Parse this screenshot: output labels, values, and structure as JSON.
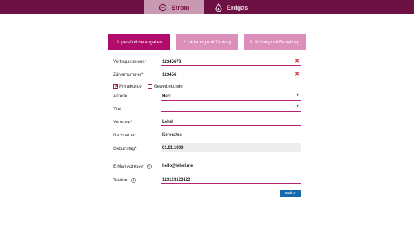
{
  "tabs": {
    "strom": {
      "label": "Strom",
      "icon": "power-icon"
    },
    "erdgas": {
      "label": "Erdgas",
      "icon": "flame-icon"
    }
  },
  "steps": [
    {
      "label": "1. persönliche Angaben",
      "active": true
    },
    {
      "label": "2. Lieferung und Zahlung",
      "active": false
    },
    {
      "label": "3. Prüfung und Bestellung",
      "active": false
    }
  ],
  "form": {
    "vertragskonto": {
      "label": "Vertragskontonr.*",
      "value": "12345678"
    },
    "zaehlernummer": {
      "label": "Zählernummer*",
      "value": "123456"
    },
    "customer_type": {
      "privat": {
        "label": "Privatkunde",
        "checked": true
      },
      "gewerbe": {
        "label": "Gewerbekunde",
        "checked": false
      }
    },
    "anrede": {
      "label": "Anrede",
      "value": "Herr"
    },
    "titel": {
      "label": "Titel",
      "value": ""
    },
    "vorname": {
      "label": "Vorname*",
      "value": "Lehel"
    },
    "nachname": {
      "label": "Nachname*",
      "value": "Keresztes"
    },
    "geburtstag": {
      "label": "Geburtstag*",
      "value": "01.01.1990"
    },
    "email": {
      "label": "E-Mail-Adresse*",
      "value": "hello@lehel.me"
    },
    "telefon": {
      "label": "Telefon*",
      "value": "123123123123"
    }
  },
  "submit_label": "weiter",
  "colors": {
    "topbar": "#6d1043",
    "active_tab": "#c89ab1",
    "step_active": "#b10c6b",
    "step_inactive": "#dc8fba",
    "underline": "#b3266f",
    "clear_icon": "#d0162a",
    "button": "#1568b0"
  }
}
